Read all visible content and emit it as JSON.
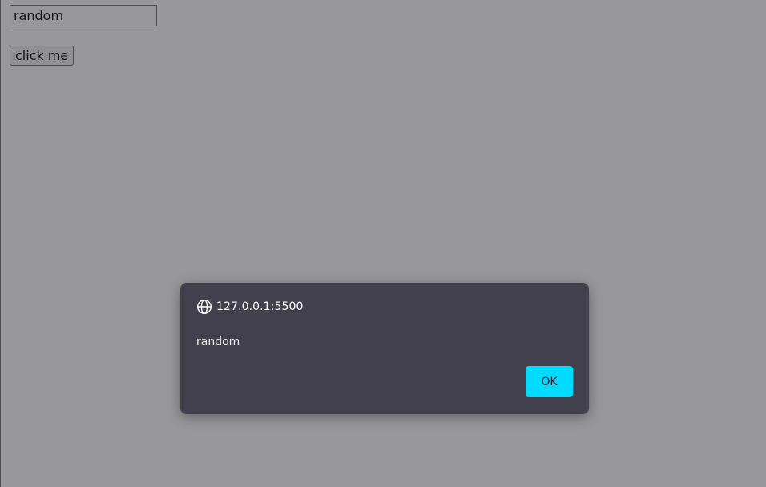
{
  "page": {
    "input_value": "random",
    "button_label": "click me"
  },
  "alert": {
    "origin": "127.0.0.1:5500",
    "origin_icon": "globe-icon",
    "message": "random",
    "ok_label": "OK",
    "accent_color": "#00dcff",
    "background_color": "#42404d"
  }
}
